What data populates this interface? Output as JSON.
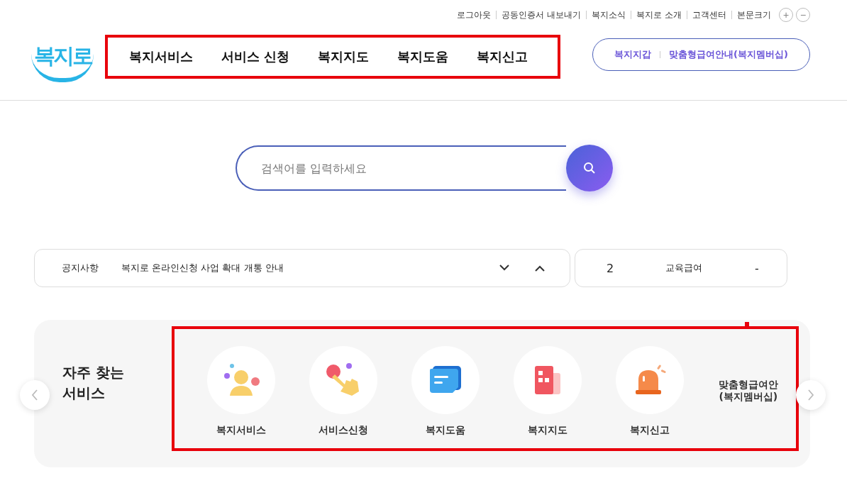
{
  "utility_links": [
    {
      "label": "로그아웃"
    },
    {
      "label": "공동인증서 내보내기"
    },
    {
      "label": "복지소식"
    },
    {
      "label": "복지로 소개"
    },
    {
      "label": "고객센터"
    },
    {
      "label": "본문크기"
    }
  ],
  "font_size_buttons": [
    {
      "label": "+"
    },
    {
      "label": "−"
    }
  ],
  "logo": {
    "text": "복지로"
  },
  "nav": {
    "highlighted": true,
    "items": [
      {
        "label": "복지서비스"
      },
      {
        "label": "서비스 신청"
      },
      {
        "label": "복지지도"
      },
      {
        "label": "복지도움"
      },
      {
        "label": "복지신고"
      }
    ]
  },
  "quick_links": [
    {
      "label": "복지지갑"
    },
    {
      "label": "맞춤형급여안내(복지멤버십)"
    }
  ],
  "search": {
    "placeholder": "검색어를 입력하세요"
  },
  "notice": {
    "category": "공지사항",
    "title": "복지로 온라인신청 사업 확대 개통 안내"
  },
  "ranking": {
    "rank": "2",
    "keyword": "교육급여",
    "change": "-"
  },
  "services": {
    "title": "자주 찾는\n서비스",
    "highlighted": true,
    "items": [
      {
        "kind": "person",
        "label": "복지서비스"
      },
      {
        "kind": "hand",
        "label": "서비스신청"
      },
      {
        "kind": "note",
        "label": "복지도움"
      },
      {
        "kind": "building",
        "label": "복지지도"
      },
      {
        "kind": "siren",
        "label": "복지신고"
      },
      {
        "kind": "text",
        "lines": [
          "맞춤형급여안",
          "(복지멤버십)"
        ]
      }
    ]
  }
}
